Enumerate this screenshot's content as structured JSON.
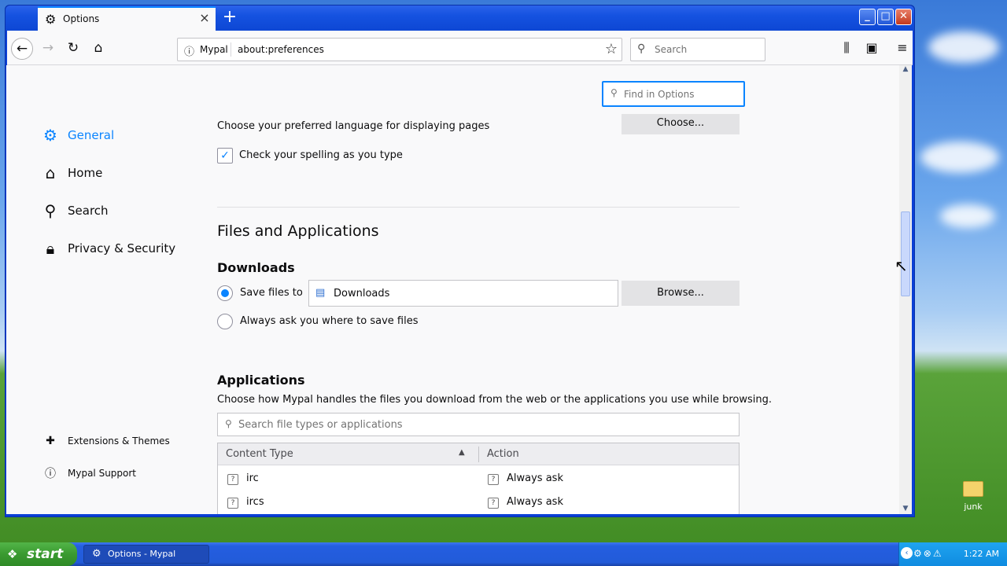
{
  "window": {
    "tab_title": "Options",
    "tab_icon": "gear-icon",
    "controls": {
      "minimize": "_",
      "maximize": "□",
      "close": "✕"
    }
  },
  "navbar": {
    "site_name": "Mypal",
    "url": "about:preferences",
    "search_placeholder": "Search"
  },
  "find": {
    "placeholder": "Find in Options"
  },
  "sidebar": {
    "items": [
      {
        "label": "General",
        "icon": "gear-icon",
        "active": true
      },
      {
        "label": "Home",
        "icon": "home-icon"
      },
      {
        "label": "Search",
        "icon": "search-icon"
      },
      {
        "label": "Privacy & Security",
        "icon": "lock-icon"
      }
    ],
    "footer": [
      {
        "label": "Extensions & Themes",
        "icon": "puzzle-icon"
      },
      {
        "label": "Mypal Support",
        "icon": "help-icon"
      }
    ]
  },
  "language": {
    "label": "Choose your preferred language for displaying pages",
    "button": "Choose...",
    "spellcheck_label": "Check your spelling as you type",
    "spellcheck_checked": true
  },
  "files": {
    "heading": "Files and Applications",
    "downloads_heading": "Downloads",
    "save_files_label": "Save files to",
    "save_files_selected": true,
    "download_folder": "Downloads",
    "browse_button": "Browse...",
    "always_ask_label": "Always ask you where to save files",
    "applications_heading": "Applications",
    "applications_desc": "Choose how Mypal handles the files you download from the web or the applications you use while browsing.",
    "apps_search_placeholder": "Search file types or applications",
    "table": {
      "col_content_type": "Content Type",
      "col_action": "Action",
      "rows": [
        {
          "type": "irc",
          "action": "Always ask"
        },
        {
          "type": "ircs",
          "action": "Always ask"
        }
      ]
    }
  },
  "taskbar": {
    "start_label": "start",
    "task_label": "Options - Mypal",
    "clock": "1:22 AM"
  },
  "desktop": {
    "icon_label": "junk"
  }
}
